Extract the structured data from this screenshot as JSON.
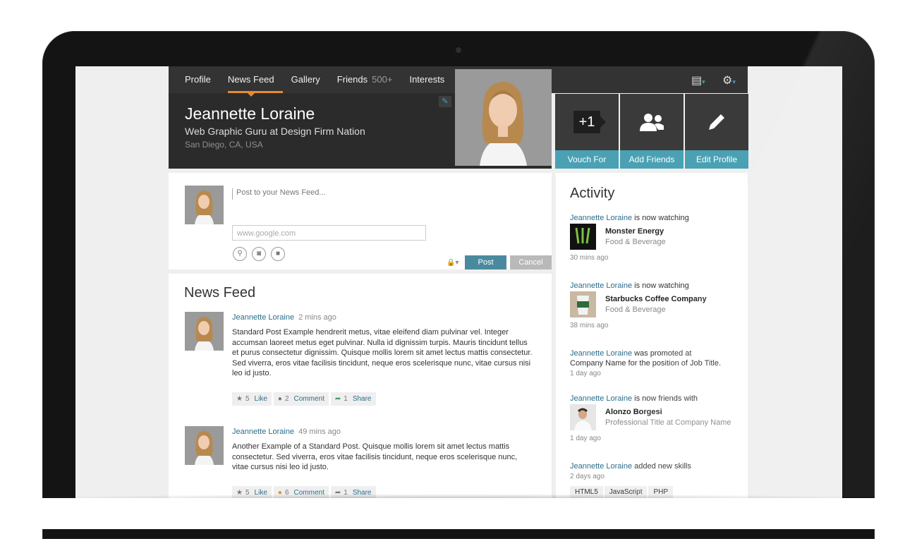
{
  "nav": {
    "items": [
      {
        "label": "Profile"
      },
      {
        "label": "News Feed"
      },
      {
        "label": "Gallery"
      },
      {
        "label": "Friends",
        "count": "500+"
      },
      {
        "label": "Interests"
      }
    ]
  },
  "profile": {
    "name": "Jeannette Loraine",
    "title": "Web Graphic Guru at Design Firm Nation",
    "location": "San Diego, CA, USA"
  },
  "actions": {
    "vouch_icon": "+1",
    "vouch": "Vouch For",
    "add_friends": "Add Friends",
    "edit_profile": "Edit Profile"
  },
  "composer": {
    "placeholder": "Post to your News Feed...",
    "url_placeholder": "www.google.com",
    "post": "Post",
    "cancel": "Cancel"
  },
  "feed": {
    "title": "News Feed",
    "posts": [
      {
        "author": "Jeannette Loraine",
        "time": "2 mins ago",
        "body": "Standard Post Example hendrerit metus, vitae eleifend diam pulvinar vel. Integer accumsan laoreet metus eget pulvinar. Nulla id dignissim turpis. Mauris tincidunt tellus et purus consectetur dignissim. Quisque mollis lorem sit amet lectus mattis consectetur. Sed viverra, eros vitae facilisis tincidunt, neque eros scelerisque nunc, vitae cursus nisi leo id justo.",
        "likes": "5",
        "like_label": "Like",
        "comments": "2",
        "comment_label": "Comment",
        "shares": "1",
        "share_label": "Share"
      },
      {
        "author": "Jeannette Loraine",
        "time": "49 mins ago",
        "body": "Another Example of a Standard Post. Quisque mollis lorem sit amet lectus mattis consectetur. Sed viverra, eros vitae facilisis tincidunt, neque eros scelerisque nunc, vitae cursus nisi leo id justo.",
        "likes": "5",
        "like_label": "Like",
        "comments": "6",
        "comment_label": "Comment",
        "shares": "1",
        "share_label": "Share"
      }
    ]
  },
  "activity": {
    "title": "Activity",
    "items": [
      {
        "who": "Jeannette Loraine",
        "text": " is now watching",
        "thumb_name": "Monster Energy",
        "thumb_sub": "Food & Beverage",
        "ago": "30 mins ago"
      },
      {
        "who": "Jeannette Loraine",
        "text": " is now watching",
        "thumb_name": "Starbucks Coffee Company",
        "thumb_sub": "Food & Beverage",
        "ago": "38 mins ago"
      },
      {
        "who": "Jeannette Loraine",
        "text": " was promoted at",
        "text2": "Company Name for the position of Job Title.",
        "ago": "1 day ago"
      },
      {
        "who": "Jeannette Loraine",
        "text": " is now friends with",
        "thumb_name": "Alonzo Borgesi",
        "thumb_sub": "Professional Title at Company Name",
        "ago": "1 day ago"
      },
      {
        "who": "Jeannette Loraine",
        "text": " added new skills",
        "ago": "2 days ago",
        "tags": [
          "HTML5",
          "JavaScript",
          "PHP"
        ]
      }
    ]
  },
  "colors": {
    "accent": "#e88a2e",
    "teal": "#4aa1b3",
    "link": "#2b6e8a"
  }
}
